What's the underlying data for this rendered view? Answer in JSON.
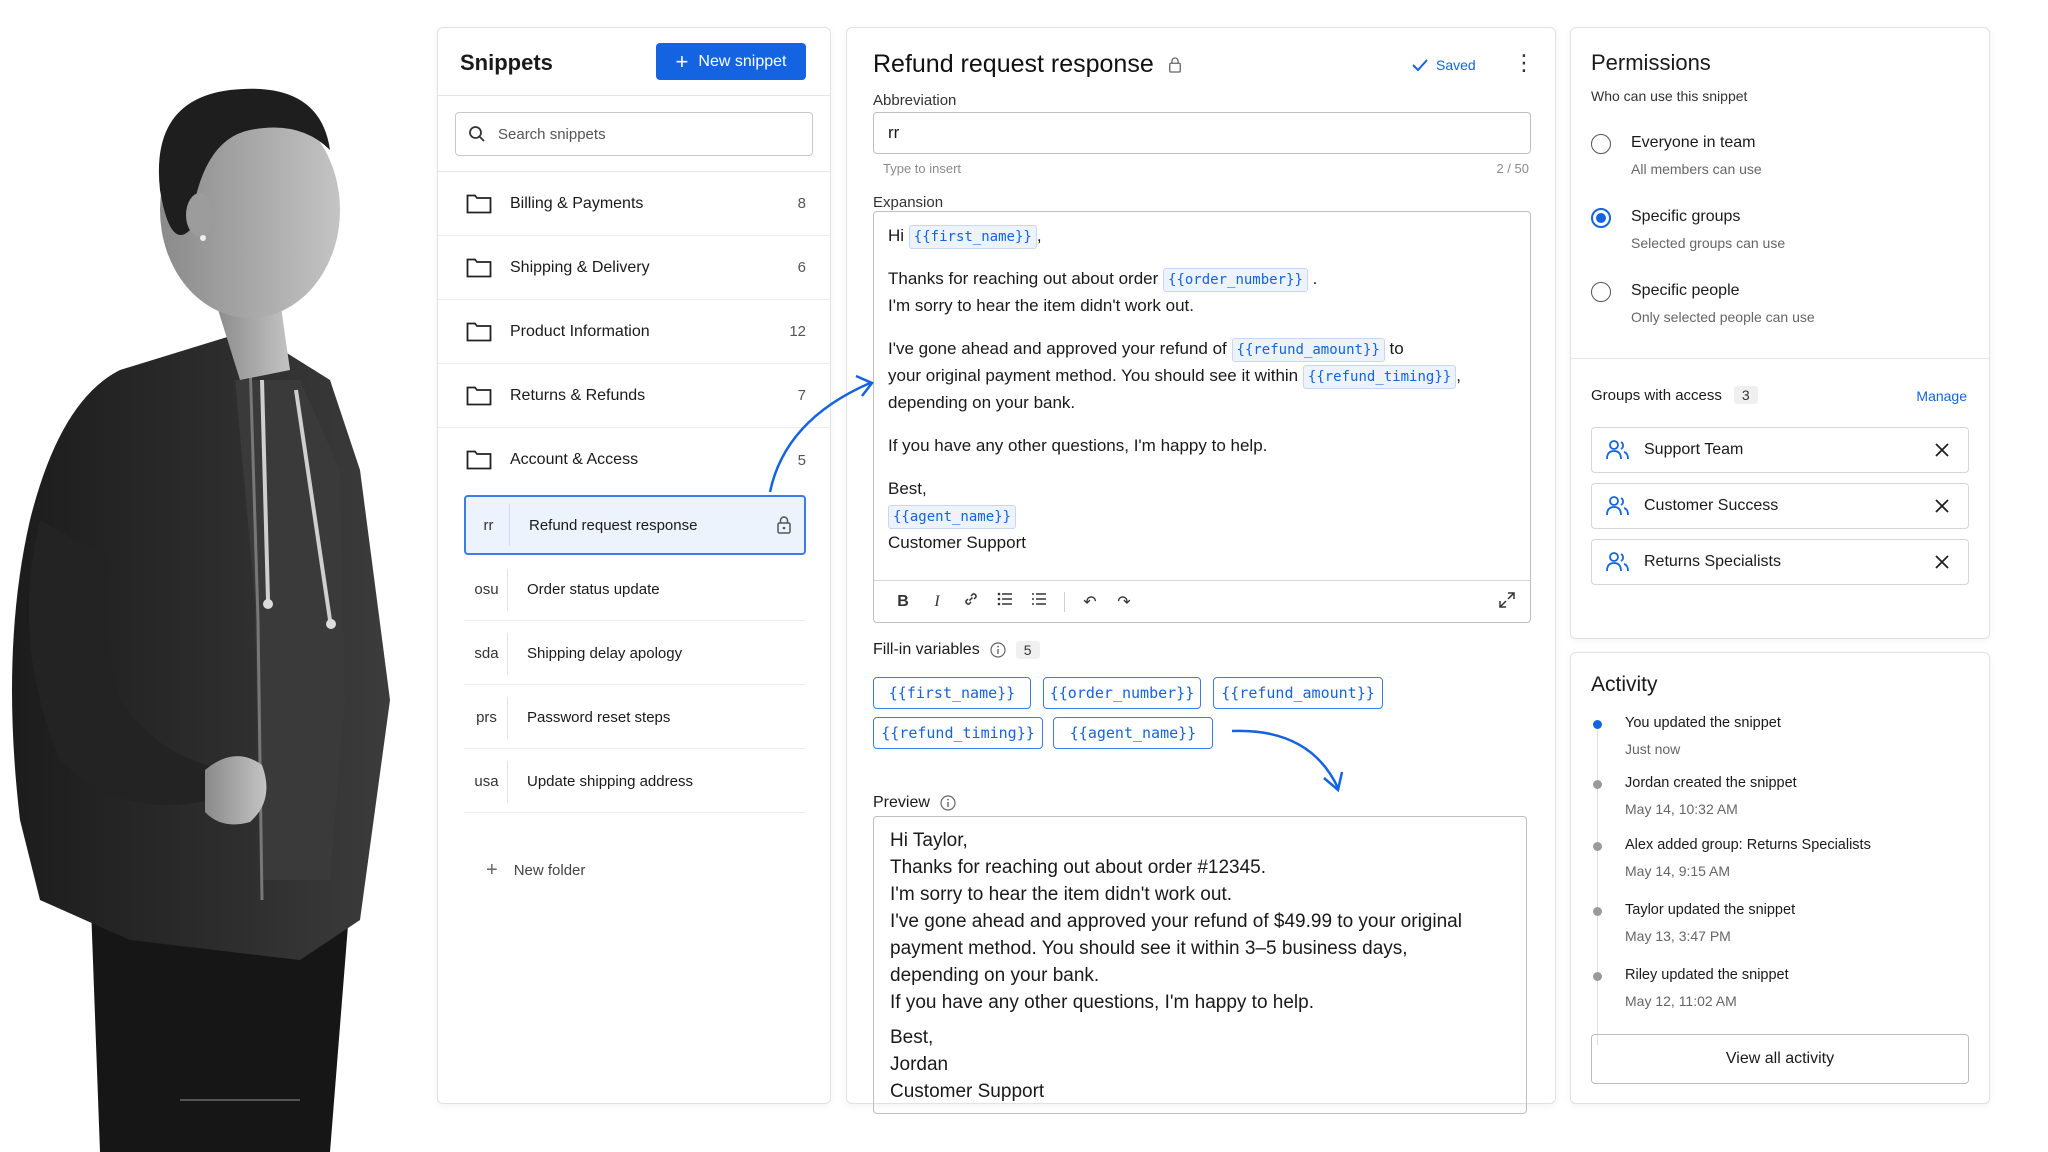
{
  "snippets": {
    "title": "Snippets",
    "new_button": "New snippet",
    "search_placeholder": "Search snippets",
    "folders": [
      {
        "label": "Billing & Payments",
        "count": "8"
      },
      {
        "label": "Shipping & Delivery",
        "count": "6"
      },
      {
        "label": "Product Information",
        "count": "12"
      },
      {
        "label": "Returns & Refunds",
        "count": "7"
      },
      {
        "label": "Account & Access",
        "count": "5"
      }
    ],
    "items": [
      {
        "abbr": "rr",
        "label": "Refund request response"
      },
      {
        "abbr": "osu",
        "label": "Order status update"
      },
      {
        "abbr": "sda",
        "label": "Shipping delay apology"
      },
      {
        "abbr": "prs",
        "label": "Password reset steps"
      },
      {
        "abbr": "usa",
        "label": "Update shipping address"
      }
    ],
    "new_folder": "New folder"
  },
  "editor": {
    "title": "Refund request response",
    "saved": "Saved",
    "abbreviation_label": "Abbreviation",
    "abbreviation_value": "rr",
    "abbreviation_hint": "Type to insert",
    "abbreviation_counter": "2 / 50",
    "expansion_label": "Expansion",
    "expansion": {
      "hi": "Hi",
      "comma": ",",
      "thanks": "Thanks for reaching out about order",
      "period": ".",
      "sorry": "I'm sorry to hear the item didn't work out.",
      "approved": "I've gone ahead and approved your refund of",
      "to": "to",
      "method": "your original payment method. You should see it within",
      "bank": "depending on your bank.",
      "questions": "If you have any other questions, I'm happy to help.",
      "best": "Best,",
      "signature": "Customer Support"
    },
    "variables": {
      "first_name": "{{first_name}}",
      "order_number": "{{order_number}}",
      "refund_amount": "{{refund_amount}}",
      "refund_timing": "{{refund_timing}}",
      "agent_name": "{{agent_name}}"
    },
    "fill_in_label": "Fill-in variables",
    "fill_in_count": "5",
    "preview_label": "Preview",
    "preview_lines": [
      "Hi Taylor,",
      "Thanks for reaching out about order #12345.",
      "I'm sorry to hear the item didn't work out.",
      "I've gone ahead and approved your refund of $49.99 to your original",
      "payment method. You should see it within 3–5 business days,",
      "depending on your bank.",
      "If you have any other questions, I'm happy to help."
    ],
    "preview_closing": [
      "Best,",
      "Jordan",
      "Customer Support"
    ]
  },
  "permissions": {
    "title": "Permissions",
    "subtitle": "Who can use this snippet",
    "options": [
      {
        "title": "Everyone in team",
        "sub": "All members can use",
        "selected": false
      },
      {
        "title": "Specific groups",
        "sub": "Selected groups can use",
        "selected": true
      },
      {
        "title": "Specific people",
        "sub": "Only selected people can use",
        "selected": false
      }
    ],
    "groups_label": "Groups with access",
    "groups_count": "3",
    "manage": "Manage",
    "groups": [
      "Support Team",
      "Customer Success",
      "Returns Specialists"
    ]
  },
  "activity": {
    "title": "Activity",
    "items": [
      {
        "text": "You updated the snippet",
        "time": "Just now"
      },
      {
        "text": "Jordan created the snippet",
        "time": "May 14, 10:32 AM"
      },
      {
        "text": "Alex added group: Returns Specialists",
        "time": "May 14, 9:15 AM"
      },
      {
        "text": "Taylor updated the snippet",
        "time": "May 13, 3:47 PM"
      },
      {
        "text": "Riley updated the snippet",
        "time": "May 12, 11:02 AM"
      }
    ],
    "view_all": "View all activity"
  },
  "colors": {
    "accent": "#1463e0",
    "selected_bg": "#edf3fd"
  }
}
